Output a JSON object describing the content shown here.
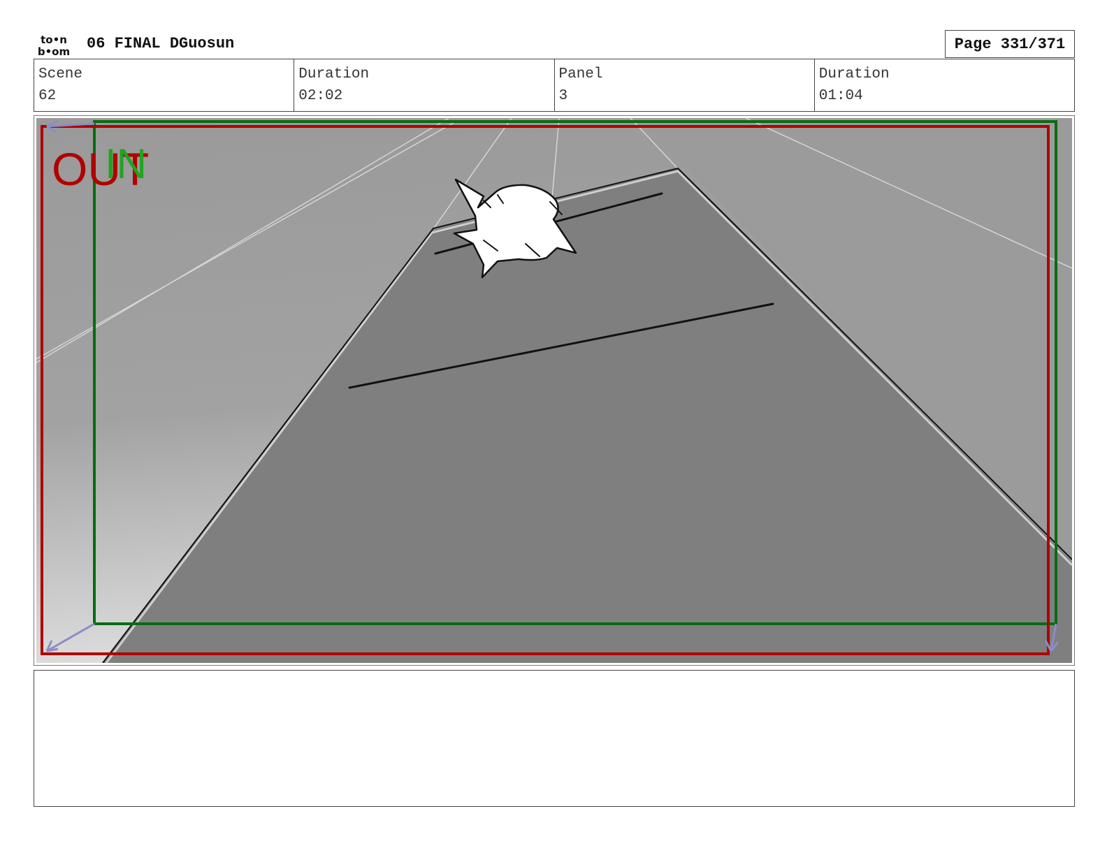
{
  "header": {
    "logo_top": "to•n",
    "logo_bottom": "b•om",
    "title": "06 FINAL DGuosun",
    "page": "Page 331/371"
  },
  "info": {
    "scene_label": "Scene",
    "scene_value": "62",
    "duration_label": "Duration",
    "duration_value": "02:02",
    "panel_label": "Panel",
    "panel_value": "3",
    "panel_duration_label": "Duration",
    "panel_duration_value": "01:04"
  },
  "panel": {
    "out_label": "OUT",
    "in_label": "IN",
    "out_color": "#b00000",
    "in_color": "#0a6b12",
    "in_text_color": "#1fa51f",
    "floor_color": "#7f7f7f",
    "wall_color": "#9a9a9a"
  },
  "notes": {
    "text": ""
  }
}
